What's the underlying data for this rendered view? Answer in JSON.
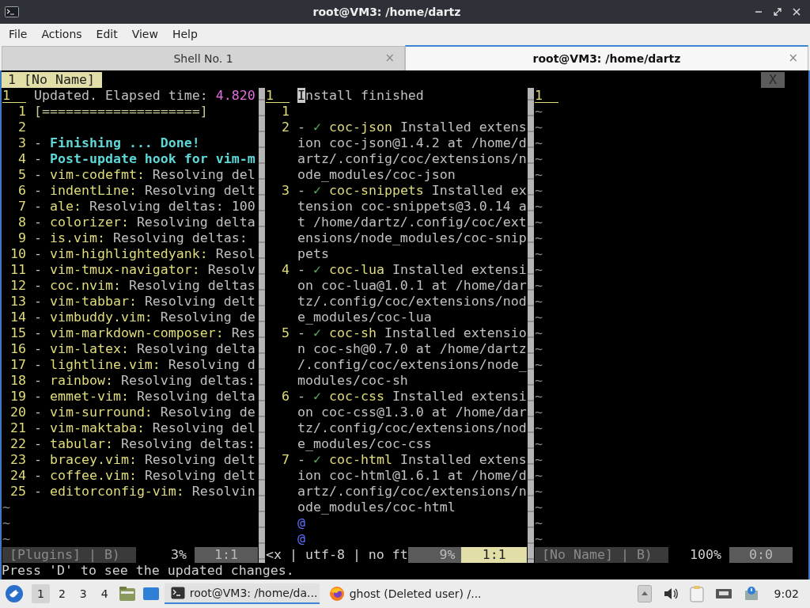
{
  "window": {
    "title": "root@VM3: /home/dartz"
  },
  "menu": [
    "File",
    "Actions",
    "Edit",
    "View",
    "Help"
  ],
  "tabs": [
    {
      "label": "Shell No. 1",
      "selected": false,
      "close": "×"
    },
    {
      "label": "root@VM3: /home/dartz",
      "selected": true,
      "close": "×"
    }
  ],
  "vim": {
    "tabline": {
      "tab": "1 [No Name]",
      "close": "X"
    },
    "panes": [
      {
        "header": {
          "num": "1",
          "segments": [
            {
              "text": "Updated. Elapsed time: ",
              "kind": "plain"
            },
            {
              "text": "4.820",
              "kind": "number"
            }
          ]
        },
        "lines": [
          {
            "kind": "numbered",
            "num": "1",
            "segments": [
              {
                "text": "[====================]",
                "kind": "bar"
              }
            ]
          },
          {
            "kind": "numbered",
            "num": "2"
          },
          {
            "kind": "numbered",
            "num": "3",
            "segments": [
              {
                "text": "- ",
                "kind": "plain"
              },
              {
                "text": "Finishing ... Done!",
                "kind": "done"
              }
            ]
          },
          {
            "kind": "numbered",
            "num": "4",
            "segments": [
              {
                "text": "- ",
                "kind": "plain"
              },
              {
                "text": "Post-update hook for vim-m",
                "kind": "done"
              }
            ]
          },
          {
            "kind": "numbered",
            "num": "5",
            "segments": [
              {
                "text": "- ",
                "kind": "plain"
              },
              {
                "text": "vim-codefmt:",
                "kind": "name"
              },
              {
                "text": " Resolving del",
                "kind": "plain"
              }
            ]
          },
          {
            "kind": "numbered",
            "num": "6",
            "segments": [
              {
                "text": "- ",
                "kind": "plain"
              },
              {
                "text": "indentLine:",
                "kind": "name"
              },
              {
                "text": " Resolving delt",
                "kind": "plain"
              }
            ]
          },
          {
            "kind": "numbered",
            "num": "7",
            "segments": [
              {
                "text": "- ",
                "kind": "plain"
              },
              {
                "text": "ale:",
                "kind": "name"
              },
              {
                "text": " Resolving deltas: 100",
                "kind": "plain"
              }
            ]
          },
          {
            "kind": "numbered",
            "num": "8",
            "segments": [
              {
                "text": "- ",
                "kind": "plain"
              },
              {
                "text": "colorizer:",
                "kind": "name"
              },
              {
                "text": " Resolving delta",
                "kind": "plain"
              }
            ]
          },
          {
            "kind": "numbered",
            "num": "9",
            "segments": [
              {
                "text": "- ",
                "kind": "plain"
              },
              {
                "text": "is.vim:",
                "kind": "name"
              },
              {
                "text": " Resolving deltas:",
                "kind": "plain"
              }
            ]
          },
          {
            "kind": "numbered",
            "num": "10",
            "segments": [
              {
                "text": "- ",
                "kind": "plain"
              },
              {
                "text": "vim-highlightedyank:",
                "kind": "name"
              },
              {
                "text": " Resol",
                "kind": "plain"
              }
            ]
          },
          {
            "kind": "numbered",
            "num": "11",
            "segments": [
              {
                "text": "- ",
                "kind": "plain"
              },
              {
                "text": "vim-tmux-navigator:",
                "kind": "name"
              },
              {
                "text": " Resolv",
                "kind": "plain"
              }
            ]
          },
          {
            "kind": "numbered",
            "num": "12",
            "segments": [
              {
                "text": "- ",
                "kind": "plain"
              },
              {
                "text": "coc.nvim:",
                "kind": "name"
              },
              {
                "text": " Resolving deltas",
                "kind": "plain"
              }
            ]
          },
          {
            "kind": "numbered",
            "num": "13",
            "segments": [
              {
                "text": "- ",
                "kind": "plain"
              },
              {
                "text": "vim-tabbar:",
                "kind": "name"
              },
              {
                "text": " Resolving delt",
                "kind": "plain"
              }
            ]
          },
          {
            "kind": "numbered",
            "num": "14",
            "segments": [
              {
                "text": "- ",
                "kind": "plain"
              },
              {
                "text": "vimbuddy.vim:",
                "kind": "name"
              },
              {
                "text": " Resolving de",
                "kind": "plain"
              }
            ]
          },
          {
            "kind": "numbered",
            "num": "15",
            "segments": [
              {
                "text": "- ",
                "kind": "plain"
              },
              {
                "text": "vim-markdown-composer:",
                "kind": "name"
              },
              {
                "text": " Res",
                "kind": "plain"
              }
            ]
          },
          {
            "kind": "numbered",
            "num": "16",
            "segments": [
              {
                "text": "- ",
                "kind": "plain"
              },
              {
                "text": "vim-latex:",
                "kind": "name"
              },
              {
                "text": " Resolving delta",
                "kind": "plain"
              }
            ]
          },
          {
            "kind": "numbered",
            "num": "17",
            "segments": [
              {
                "text": "- ",
                "kind": "plain"
              },
              {
                "text": "lightline.vim:",
                "kind": "name"
              },
              {
                "text": " Resolving d",
                "kind": "plain"
              }
            ]
          },
          {
            "kind": "numbered",
            "num": "18",
            "segments": [
              {
                "text": "- ",
                "kind": "plain"
              },
              {
                "text": "rainbow:",
                "kind": "name"
              },
              {
                "text": " Resolving deltas:",
                "kind": "plain"
              }
            ]
          },
          {
            "kind": "numbered",
            "num": "19",
            "segments": [
              {
                "text": "- ",
                "kind": "plain"
              },
              {
                "text": "emmet-vim:",
                "kind": "name"
              },
              {
                "text": " Resolving delta",
                "kind": "plain"
              }
            ]
          },
          {
            "kind": "numbered",
            "num": "20",
            "segments": [
              {
                "text": "- ",
                "kind": "plain"
              },
              {
                "text": "vim-surround:",
                "kind": "name"
              },
              {
                "text": " Resolving de",
                "kind": "plain"
              }
            ]
          },
          {
            "kind": "numbered",
            "num": "21",
            "segments": [
              {
                "text": "- ",
                "kind": "plain"
              },
              {
                "text": "vim-maktaba:",
                "kind": "name"
              },
              {
                "text": " Resolving del",
                "kind": "plain"
              }
            ]
          },
          {
            "kind": "numbered",
            "num": "22",
            "segments": [
              {
                "text": "- ",
                "kind": "plain"
              },
              {
                "text": "tabular:",
                "kind": "name"
              },
              {
                "text": " Resolving deltas:",
                "kind": "plain"
              }
            ]
          },
          {
            "kind": "numbered",
            "num": "23",
            "segments": [
              {
                "text": "- ",
                "kind": "plain"
              },
              {
                "text": "bracey.vim:",
                "kind": "name"
              },
              {
                "text": " Resolving delt",
                "kind": "plain"
              }
            ]
          },
          {
            "kind": "numbered",
            "num": "24",
            "segments": [
              {
                "text": "- ",
                "kind": "plain"
              },
              {
                "text": "coffee.vim:",
                "kind": "name"
              },
              {
                "text": " Resolving delt",
                "kind": "plain"
              }
            ]
          },
          {
            "kind": "numbered",
            "num": "25",
            "segments": [
              {
                "text": "- ",
                "kind": "plain"
              },
              {
                "text": "editorconfig-vim:",
                "kind": "name"
              },
              {
                "text": " Resolvin",
                "kind": "plain"
              }
            ]
          },
          {
            "kind": "filler",
            "segments": [
              {
                "text": "~",
                "kind": "tilde"
              }
            ]
          },
          {
            "kind": "filler",
            "segments": [
              {
                "text": "~",
                "kind": "tilde"
              }
            ]
          },
          {
            "kind": "filler",
            "segments": [
              {
                "text": "~",
                "kind": "tilde"
              }
            ]
          }
        ],
        "status": [
          {
            "text": "[Plugins] | B)",
            "kind": "file"
          },
          {
            "text": "3%",
            "kind": "percent"
          },
          {
            "text": "1:1",
            "kind": "position"
          }
        ]
      },
      {
        "header": {
          "num": "1",
          "segments": [
            {
              "text": "I",
              "kind": "cursor"
            },
            {
              "text": "nstall finished",
              "kind": "plain"
            }
          ]
        },
        "lines": [
          {
            "kind": "numbered",
            "num": "1"
          },
          {
            "kind": "numbered",
            "num": "2",
            "segments": [
              {
                "text": "- ",
                "kind": "plain"
              },
              {
                "text": "✓ ",
                "kind": "check"
              },
              {
                "text": "coc-json",
                "kind": "name"
              },
              {
                "text": " Installed extens",
                "kind": "plain"
              }
            ]
          },
          {
            "kind": "wrap",
            "segments": [
              {
                "text": "ion coc-json@1.4.2 at /home/d",
                "kind": "plain"
              }
            ]
          },
          {
            "kind": "wrap",
            "segments": [
              {
                "text": "artz/.config/coc/extensions/n",
                "kind": "plain"
              }
            ]
          },
          {
            "kind": "wrap",
            "segments": [
              {
                "text": "ode_modules/coc-json",
                "kind": "plain"
              }
            ]
          },
          {
            "kind": "numbered",
            "num": "3",
            "segments": [
              {
                "text": "- ",
                "kind": "plain"
              },
              {
                "text": "✓ ",
                "kind": "check"
              },
              {
                "text": "coc-snippets",
                "kind": "name"
              },
              {
                "text": " Installed ex",
                "kind": "plain"
              }
            ]
          },
          {
            "kind": "wrap",
            "segments": [
              {
                "text": "tension coc-snippets@3.0.14 a",
                "kind": "plain"
              }
            ]
          },
          {
            "kind": "wrap",
            "segments": [
              {
                "text": "t /home/dartz/.config/coc/ext",
                "kind": "plain"
              }
            ]
          },
          {
            "kind": "wrap",
            "segments": [
              {
                "text": "ensions/node_modules/coc-snip",
                "kind": "plain"
              }
            ]
          },
          {
            "kind": "wrap",
            "segments": [
              {
                "text": "pets",
                "kind": "plain"
              }
            ]
          },
          {
            "kind": "numbered",
            "num": "4",
            "segments": [
              {
                "text": "- ",
                "kind": "plain"
              },
              {
                "text": "✓ ",
                "kind": "check"
              },
              {
                "text": "coc-lua",
                "kind": "name"
              },
              {
                "text": " Installed extensi",
                "kind": "plain"
              }
            ]
          },
          {
            "kind": "wrap",
            "segments": [
              {
                "text": "on coc-lua@1.0.1 at /home/dar",
                "kind": "plain"
              }
            ]
          },
          {
            "kind": "wrap",
            "segments": [
              {
                "text": "tz/.config/coc/extensions/nod",
                "kind": "plain"
              }
            ]
          },
          {
            "kind": "wrap",
            "segments": [
              {
                "text": "e_modules/coc-lua",
                "kind": "plain"
              }
            ]
          },
          {
            "kind": "numbered",
            "num": "5",
            "segments": [
              {
                "text": "- ",
                "kind": "plain"
              },
              {
                "text": "✓ ",
                "kind": "check"
              },
              {
                "text": "coc-sh",
                "kind": "name"
              },
              {
                "text": " Installed extensio",
                "kind": "plain"
              }
            ]
          },
          {
            "kind": "wrap",
            "segments": [
              {
                "text": "n coc-sh@0.7.0 at /home/dartz",
                "kind": "plain"
              }
            ]
          },
          {
            "kind": "wrap",
            "segments": [
              {
                "text": "/.config/coc/extensions/node_",
                "kind": "plain"
              }
            ]
          },
          {
            "kind": "wrap",
            "segments": [
              {
                "text": "modules/coc-sh",
                "kind": "plain"
              }
            ]
          },
          {
            "kind": "numbered",
            "num": "6",
            "segments": [
              {
                "text": "- ",
                "kind": "plain"
              },
              {
                "text": "✓ ",
                "kind": "check"
              },
              {
                "text": "coc-css",
                "kind": "name"
              },
              {
                "text": " Installed extensi",
                "kind": "plain"
              }
            ]
          },
          {
            "kind": "wrap",
            "segments": [
              {
                "text": "on coc-css@1.3.0 at /home/dar",
                "kind": "plain"
              }
            ]
          },
          {
            "kind": "wrap",
            "segments": [
              {
                "text": "tz/.config/coc/extensions/nod",
                "kind": "plain"
              }
            ]
          },
          {
            "kind": "wrap",
            "segments": [
              {
                "text": "e_modules/coc-css",
                "kind": "plain"
              }
            ]
          },
          {
            "kind": "numbered",
            "num": "7",
            "segments": [
              {
                "text": "- ",
                "kind": "plain"
              },
              {
                "text": "✓ ",
                "kind": "check"
              },
              {
                "text": "coc-html",
                "kind": "name"
              },
              {
                "text": " Installed extens",
                "kind": "plain"
              }
            ]
          },
          {
            "kind": "wrap",
            "segments": [
              {
                "text": "ion coc-html@1.6.1 at /home/d",
                "kind": "plain"
              }
            ]
          },
          {
            "kind": "wrap",
            "segments": [
              {
                "text": "artz/.config/coc/extensions/n",
                "kind": "plain"
              }
            ]
          },
          {
            "kind": "wrap",
            "segments": [
              {
                "text": "ode_modules/coc-html",
                "kind": "plain"
              }
            ]
          },
          {
            "kind": "wrap",
            "segments": [
              {
                "text": "@",
                "kind": "at"
              }
            ]
          },
          {
            "kind": "wrap",
            "segments": [
              {
                "text": "@",
                "kind": "at"
              }
            ]
          }
        ],
        "status": [
          {
            "text": "<x | utf-8 | no ft",
            "kind": "info"
          },
          {
            "text": "9%",
            "kind": "percent_hl"
          },
          {
            "text": "1:1",
            "kind": "position_active"
          }
        ]
      },
      {
        "header": {
          "num": "1"
        },
        "lines": [
          {
            "kind": "filler",
            "segments": [
              {
                "text": "~",
                "kind": "tilde"
              }
            ]
          },
          {
            "kind": "filler",
            "segments": [
              {
                "text": "~",
                "kind": "tilde"
              }
            ]
          },
          {
            "kind": "filler",
            "segments": [
              {
                "text": "~",
                "kind": "tilde"
              }
            ]
          },
          {
            "kind": "filler",
            "segments": [
              {
                "text": "~",
                "kind": "tilde"
              }
            ]
          },
          {
            "kind": "filler",
            "segments": [
              {
                "text": "~",
                "kind": "tilde"
              }
            ]
          },
          {
            "kind": "filler",
            "segments": [
              {
                "text": "~",
                "kind": "tilde"
              }
            ]
          },
          {
            "kind": "filler",
            "segments": [
              {
                "text": "~",
                "kind": "tilde"
              }
            ]
          },
          {
            "kind": "filler",
            "segments": [
              {
                "text": "~",
                "kind": "tilde"
              }
            ]
          },
          {
            "kind": "filler",
            "segments": [
              {
                "text": "~",
                "kind": "tilde"
              }
            ]
          },
          {
            "kind": "filler",
            "segments": [
              {
                "text": "~",
                "kind": "tilde"
              }
            ]
          },
          {
            "kind": "filler",
            "segments": [
              {
                "text": "~",
                "kind": "tilde"
              }
            ]
          },
          {
            "kind": "filler",
            "segments": [
              {
                "text": "~",
                "kind": "tilde"
              }
            ]
          },
          {
            "kind": "filler",
            "segments": [
              {
                "text": "~",
                "kind": "tilde"
              }
            ]
          },
          {
            "kind": "filler",
            "segments": [
              {
                "text": "~",
                "kind": "tilde"
              }
            ]
          },
          {
            "kind": "filler",
            "segments": [
              {
                "text": "~",
                "kind": "tilde"
              }
            ]
          },
          {
            "kind": "filler",
            "segments": [
              {
                "text": "~",
                "kind": "tilde"
              }
            ]
          },
          {
            "kind": "filler",
            "segments": [
              {
                "text": "~",
                "kind": "tilde"
              }
            ]
          },
          {
            "kind": "filler",
            "segments": [
              {
                "text": "~",
                "kind": "tilde"
              }
            ]
          },
          {
            "kind": "filler",
            "segments": [
              {
                "text": "~",
                "kind": "tilde"
              }
            ]
          },
          {
            "kind": "filler",
            "segments": [
              {
                "text": "~",
                "kind": "tilde"
              }
            ]
          },
          {
            "kind": "filler",
            "segments": [
              {
                "text": "~",
                "kind": "tilde"
              }
            ]
          },
          {
            "kind": "filler",
            "segments": [
              {
                "text": "~",
                "kind": "tilde"
              }
            ]
          },
          {
            "kind": "filler",
            "segments": [
              {
                "text": "~",
                "kind": "tilde"
              }
            ]
          },
          {
            "kind": "filler",
            "segments": [
              {
                "text": "~",
                "kind": "tilde"
              }
            ]
          },
          {
            "kind": "filler",
            "segments": [
              {
                "text": "~",
                "kind": "tilde"
              }
            ]
          },
          {
            "kind": "filler",
            "segments": [
              {
                "text": "~",
                "kind": "tilde"
              }
            ]
          },
          {
            "kind": "filler",
            "segments": [
              {
                "text": "~",
                "kind": "tilde"
              }
            ]
          },
          {
            "kind": "filler",
            "segments": [
              {
                "text": "~",
                "kind": "tilde"
              }
            ]
          }
        ],
        "status": [
          {
            "text": "[No Name] | B)",
            "kind": "file"
          },
          {
            "text": "100%",
            "kind": "percent"
          },
          {
            "text": "0:0",
            "kind": "position"
          }
        ]
      }
    ],
    "message": "Press 'D' to see the updated changes."
  },
  "taskbar": {
    "workspaces": [
      {
        "label": "1",
        "selected": true
      },
      {
        "label": "2",
        "selected": false
      },
      {
        "label": "3",
        "selected": false
      },
      {
        "label": "4",
        "selected": false
      }
    ],
    "tasks": [
      {
        "label": "root@VM3: /home/da...",
        "kind": "terminal",
        "selected": true
      },
      {
        "label": "ghost (Deleted user) /...",
        "kind": "browser",
        "selected": false
      }
    ],
    "clock": "9:02"
  }
}
